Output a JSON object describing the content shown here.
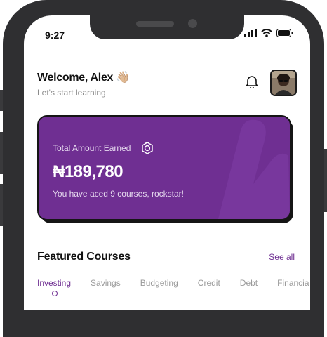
{
  "status_bar": {
    "time": "9:27"
  },
  "header": {
    "greeting": "Welcome, Alex",
    "greeting_emoji": "👋🏼",
    "subtitle": "Let's start learning"
  },
  "earnings_card": {
    "label": "Total Amount Earned",
    "amount": "₦189,780",
    "note": "You have aced 9 courses, rockstar!",
    "color": "#6f2f92"
  },
  "featured": {
    "title": "Featured Courses",
    "see_all": "See all",
    "tabs": [
      {
        "label": "Investing",
        "active": true
      },
      {
        "label": "Savings"
      },
      {
        "label": "Budgeting"
      },
      {
        "label": "Credit"
      },
      {
        "label": "Debt"
      },
      {
        "label": "Financia"
      }
    ]
  },
  "colors": {
    "accent": "#6f2f92",
    "frame": "#2f2f31"
  },
  "icons": [
    "signal-icon",
    "wifi-icon",
    "battery-icon",
    "bell-icon",
    "coin-icon",
    "avatar"
  ]
}
